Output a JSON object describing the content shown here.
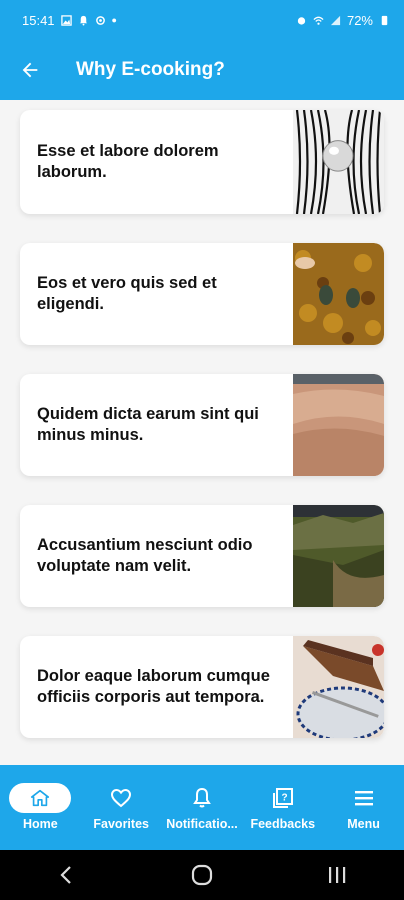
{
  "status_bar": {
    "time": "15:41",
    "battery": "72%"
  },
  "app_bar": {
    "title": "Why E-cooking?",
    "back_icon": "arrow-back-icon"
  },
  "cards": [
    {
      "text": "Esse et labore dolorem laborum.",
      "image": "abstract-sphere-lines"
    },
    {
      "text": "Eos et vero quis sed et eligendi.",
      "image": "autumn-leaves-shoes"
    },
    {
      "text": "Quidem dicta earum sint qui minus minus.",
      "image": "desert-dunes"
    },
    {
      "text": "Accusantium nesciunt odio voluptate nam velit.",
      "image": "mountain-valley"
    },
    {
      "text": "Dolor eaque laborum cumque officiis corporis aut tempora.",
      "image": "cake-plate"
    }
  ],
  "bottom_nav": {
    "items": [
      {
        "label": "Home",
        "icon": "home-icon",
        "active": true
      },
      {
        "label": "Favorites",
        "icon": "heart-icon",
        "active": false
      },
      {
        "label": "Notificatio...",
        "icon": "bell-icon",
        "active": false
      },
      {
        "label": "Feedbacks",
        "icon": "feedback-icon",
        "active": false
      },
      {
        "label": "Menu",
        "icon": "menu-icon",
        "active": false
      }
    ]
  },
  "colors": {
    "primary": "#1ea7ea",
    "background": "#f5f5f5",
    "card": "#ffffff"
  }
}
